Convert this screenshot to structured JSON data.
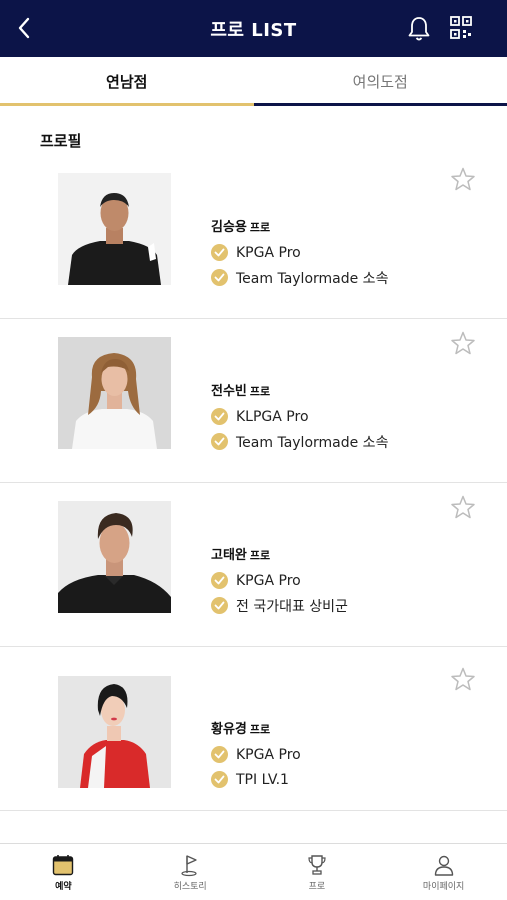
{
  "header": {
    "title": "프로 LIST"
  },
  "tabs": [
    {
      "label": "연남점",
      "active": true
    },
    {
      "label": "여의도점",
      "active": false
    }
  ],
  "section_title": "프로필",
  "suffix": "프로",
  "pros": [
    {
      "name": "김승용",
      "tags": [
        "KPGA Pro",
        "Team Taylormade 소속"
      ]
    },
    {
      "name": "전수빈",
      "tags": [
        "KLPGA Pro",
        "Team Taylormade 소속"
      ]
    },
    {
      "name": "고태완",
      "tags": [
        "KPGA Pro",
        "전 국가대표 상비군"
      ]
    },
    {
      "name": "황유경",
      "tags": [
        "KPGA Pro",
        "TPI LV.1"
      ]
    }
  ],
  "bottom_nav": [
    {
      "label": "예약",
      "icon": "calendar-icon",
      "active": true
    },
    {
      "label": "히스토리",
      "icon": "golf-flag-icon",
      "active": false
    },
    {
      "label": "프로",
      "icon": "trophy-icon",
      "active": false
    },
    {
      "label": "마이페이지",
      "icon": "person-icon",
      "active": false
    }
  ],
  "colors": {
    "header_bg": "#0c1448",
    "accent_gold": "#e2c26e"
  }
}
